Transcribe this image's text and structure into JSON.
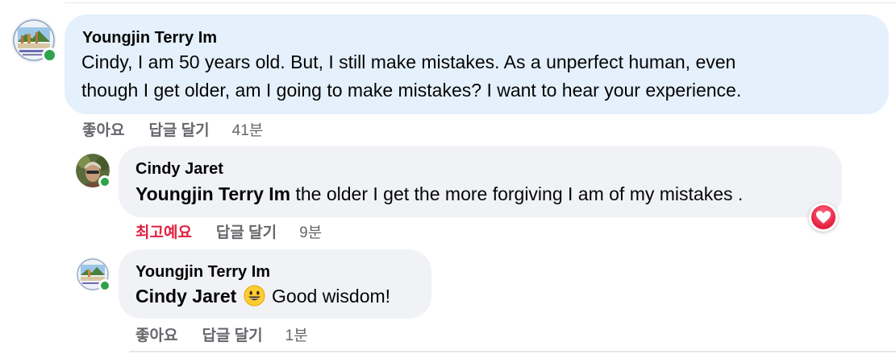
{
  "comments": [
    {
      "author": "Youngjin Terry Im",
      "lines": [
        "Cindy, I am 50 years old. But, I still make mistakes. As a unperfect human, even",
        "though I get older, am I going to make mistakes? I want to hear your experience."
      ],
      "actions": {
        "like": "좋아요",
        "reply": "답글 달기",
        "time": "41분"
      }
    },
    {
      "author": "Cindy Jaret",
      "mention": "Youngjin Terry Im",
      "text": " the older I get the more forgiving I am of my mistakes .",
      "actions": {
        "like": "최고예요",
        "reply": "답글 달기",
        "time": "9분"
      },
      "reaction_icon": "heart-icon",
      "reaction_color": "#e41e3f"
    },
    {
      "author": "Youngjin Terry Im",
      "mention": "Cindy Jaret",
      "emoji_icon": "grinning-face-icon",
      "text": "Good wisdom!",
      "actions": {
        "like": "좋아요",
        "reply": "답글 달기",
        "time": "1분"
      }
    }
  ],
  "colors": {
    "online": "#31a24c",
    "bubble_highlight": "#e4f0fb",
    "bubble": "#f0f2f5",
    "action_text": "#65676b",
    "love_red": "#e41e3f"
  }
}
